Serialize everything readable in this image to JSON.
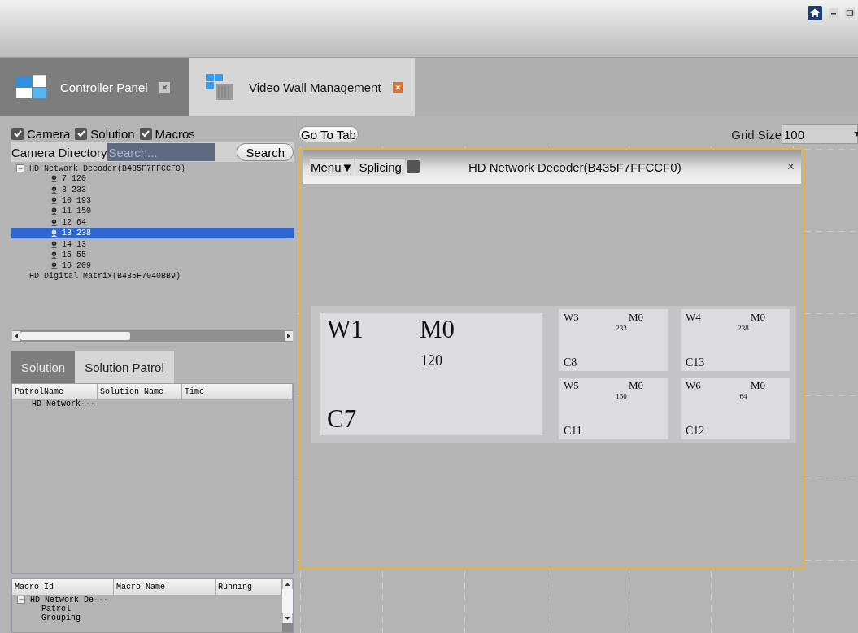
{
  "tabs": [
    {
      "label": "Controller Panel",
      "selected": false
    },
    {
      "label": "Video Wall Management",
      "selected": true
    }
  ],
  "filters": [
    {
      "label": "Camera",
      "checked": true
    },
    {
      "label": "Solution",
      "checked": true
    },
    {
      "label": "Macros",
      "checked": true
    }
  ],
  "camera_directory": {
    "label": "Camera Directory",
    "search": {
      "placeholder": "Search..."
    },
    "search_button": "Search",
    "tree": [
      {
        "label": "HD Network Decoder(B435F7FFCCF0)",
        "expanded": true,
        "children": [
          {
            "label": "7 120",
            "selected": false
          },
          {
            "label": "8 233",
            "selected": false
          },
          {
            "label": "10 193",
            "selected": false
          },
          {
            "label": "11 150",
            "selected": false
          },
          {
            "label": "12 64",
            "selected": false
          },
          {
            "label": "13 238",
            "selected": true
          },
          {
            "label": "14 13",
            "selected": false
          },
          {
            "label": "15 55",
            "selected": false
          },
          {
            "label": "16 209",
            "selected": false
          }
        ]
      },
      {
        "label": "HD Digital Matrix(B435F7040BB9)"
      }
    ]
  },
  "solution_tabs": [
    {
      "label": "Solution",
      "selected": false
    },
    {
      "label": "Solution Patrol",
      "selected": true
    }
  ],
  "patrol_table": {
    "columns": [
      "PatrolName",
      "Solution Name",
      "Time"
    ],
    "rows": [
      "HD Network···"
    ]
  },
  "macro_table": {
    "columns": [
      "Macro Id",
      "Macro Name",
      "Running"
    ],
    "tree": [
      {
        "label": "HD Network De···",
        "expanded": true,
        "children": [
          "Patrol",
          "Grouping"
        ]
      }
    ]
  },
  "toolbar": {
    "goto_button": "Go To Tab",
    "grid_size_label": "Grid Size",
    "grid_size_value": "100"
  },
  "decoder_window": {
    "menu": "Menu▼",
    "splicing_label": "Splicing",
    "title": "HD Network Decoder(B435F7FFCCF0)",
    "close": "×",
    "wall_windows": [
      {
        "kind": "large",
        "window": "W1",
        "mode": "M0",
        "channel": "120",
        "camera": "C7"
      },
      {
        "kind": "small",
        "window": "W3",
        "mode": "M0",
        "channel": "233",
        "camera": "C8"
      },
      {
        "kind": "small",
        "window": "W4",
        "mode": "M0",
        "channel": "238",
        "camera": "C13"
      },
      {
        "kind": "small",
        "window": "W5",
        "mode": "M0",
        "channel": "150",
        "camera": "C11"
      },
      {
        "kind": "small",
        "window": "W6",
        "mode": "M0",
        "channel": "64",
        "camera": "C12"
      }
    ]
  }
}
